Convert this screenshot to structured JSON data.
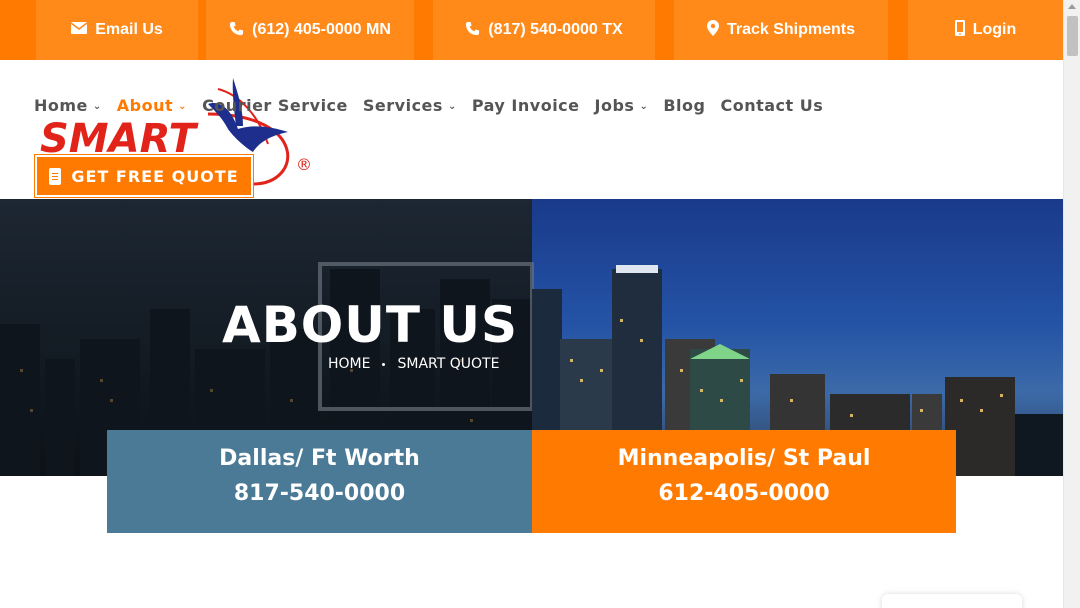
{
  "topbar": {
    "email_label": "Email Us",
    "phone_mn_label": "(612) 405-0000 MN",
    "phone_tx_label": "(817) 540-0000 TX",
    "track_label": "Track Shipments",
    "login_label": "Login"
  },
  "brand": {
    "logo_text": "SMART",
    "reg_mark": "®"
  },
  "nav": {
    "items": [
      {
        "label": "Home",
        "dropdown": true
      },
      {
        "label": "About",
        "dropdown": true,
        "active": true
      },
      {
        "label": "Courier Service",
        "dropdown": false
      },
      {
        "label": "Services",
        "dropdown": true
      },
      {
        "label": "Pay Invoice",
        "dropdown": false
      },
      {
        "label": "Jobs",
        "dropdown": true
      },
      {
        "label": "Blog",
        "dropdown": false
      },
      {
        "label": "Contact Us",
        "dropdown": false
      }
    ],
    "quote_button_label": "GET FREE QUOTE"
  },
  "hero": {
    "title": "ABOUT US",
    "breadcrumb": [
      "HOME",
      "SMART QUOTE"
    ]
  },
  "locations": [
    {
      "city": "Dallas/ Ft Worth",
      "phone": "817-540-0000"
    },
    {
      "city": "Minneapolis/ St Paul",
      "phone": "612-405-0000"
    }
  ],
  "colors": {
    "brand_orange": "#ff7a00",
    "dallas_blue": "#4a7a96",
    "nav_text": "#555555"
  }
}
